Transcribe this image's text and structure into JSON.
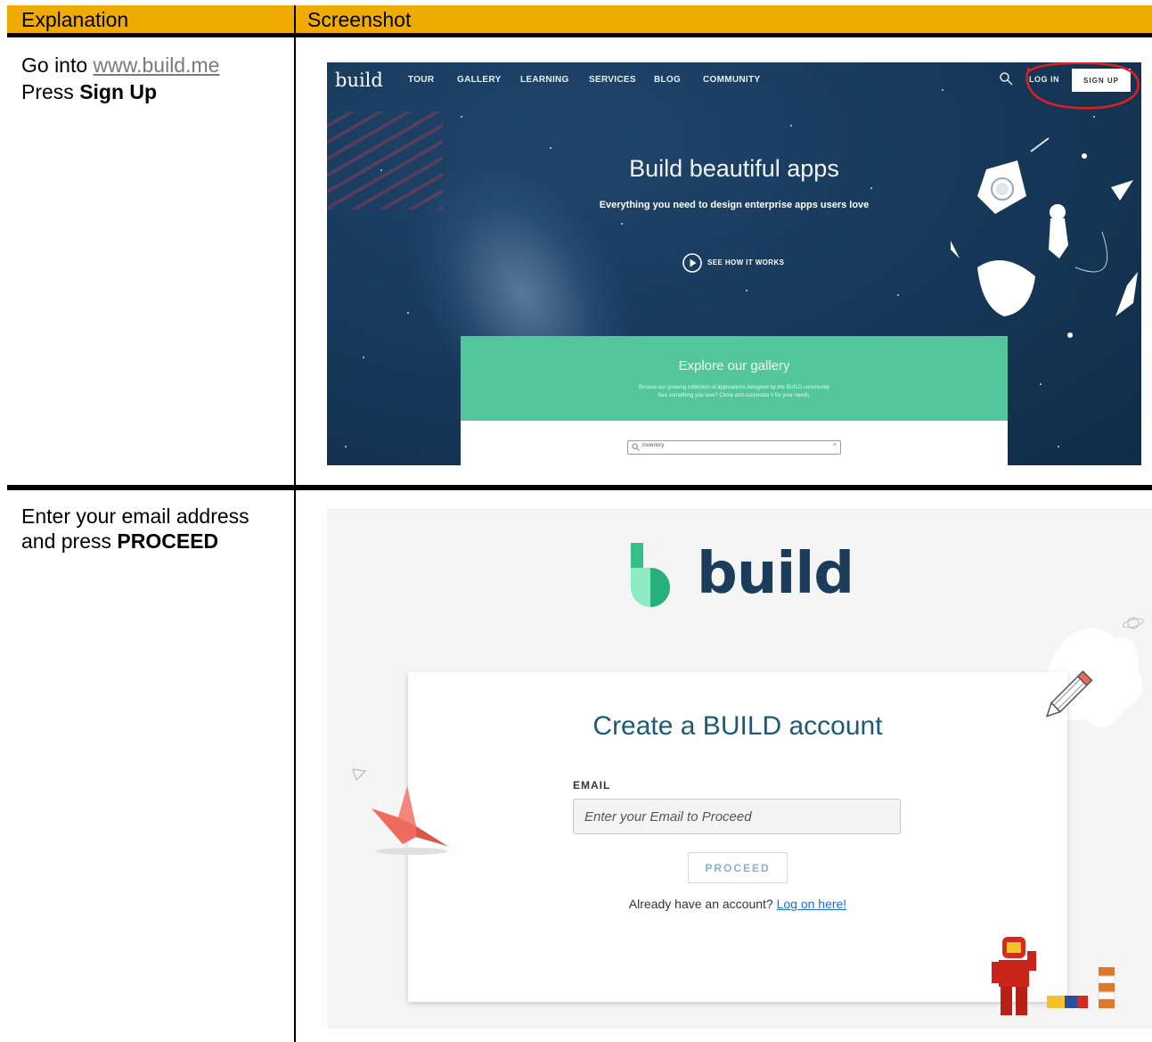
{
  "table": {
    "col_explanation": "Explanation",
    "col_screenshot": "Screenshot",
    "accent_color": "#f0ab00"
  },
  "step1": {
    "text_prefix": "Go into ",
    "link": "www.build.me",
    "text_press": "Press ",
    "action": "Sign Up"
  },
  "step2": {
    "line1": "Enter your email address",
    "line2_prefix": "and press ",
    "action": "PROCEED"
  },
  "shot1": {
    "logo": "build",
    "nav": [
      "TOUR",
      "GALLERY",
      "LEARNING",
      "SERVICES",
      "BLOG",
      "COMMUNITY"
    ],
    "login": "LOG IN",
    "signup": "SIGN UP",
    "hero_title": "Build beautiful apps",
    "hero_subtitle": "Everything you need to design enterprise apps users love",
    "see_how": "SEE HOW IT WORKS",
    "gallery_title": "Explore our gallery",
    "gallery_line1": "Browse our growing collection of applications designed by the BUILD community",
    "gallery_line2": "See something you love? Clone and customize it for your needs.",
    "search_value": "inventory",
    "search_clear": "×",
    "hero_bg_color": "#173a5c",
    "gallery_color": "#53c79b",
    "highlight_color": "#e02020"
  },
  "shot2": {
    "brand": "build",
    "card_title": "Create a BUILD account",
    "email_label": "EMAIL",
    "email_placeholder": "Enter your Email to Proceed",
    "proceed": "PROCEED",
    "already_text": "Already have an account? ",
    "login_link": "Log on here!",
    "title_color": "#1a5a7a",
    "brand_color": "#1c3d5a"
  }
}
